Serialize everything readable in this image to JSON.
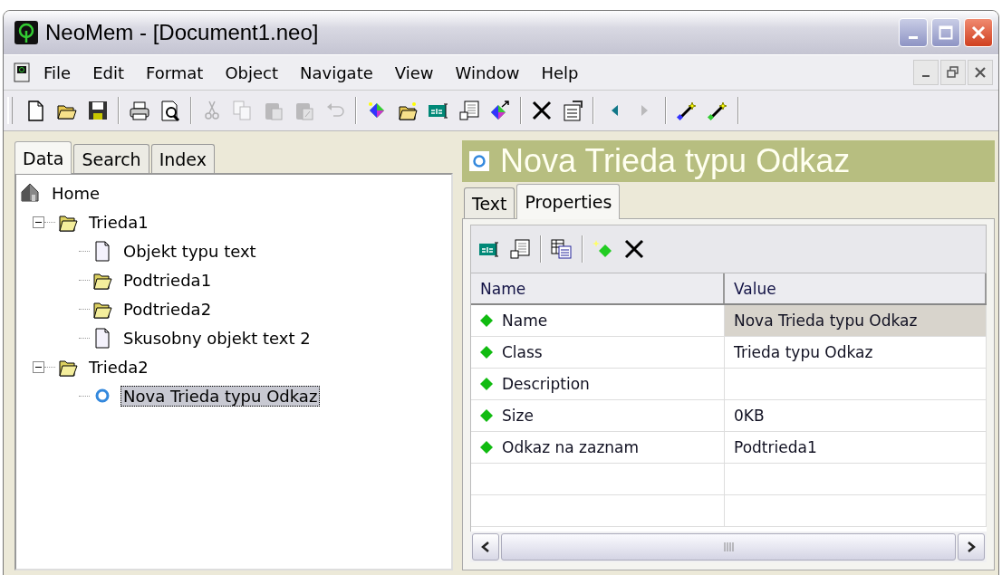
{
  "window": {
    "title": "NeoMem - [Document1.neo]"
  },
  "menu": [
    {
      "label": "File"
    },
    {
      "label": "Edit"
    },
    {
      "label": "Format"
    },
    {
      "label": "Object"
    },
    {
      "label": "Navigate"
    },
    {
      "label": "View"
    },
    {
      "label": "Window"
    },
    {
      "label": "Help"
    }
  ],
  "main_toolbar": [
    {
      "kind": "button",
      "disabled": false
    },
    {
      "kind": "button",
      "disabled": false
    },
    {
      "kind": "button",
      "disabled": false
    },
    {
      "kind": "separator"
    },
    {
      "kind": "button",
      "disabled": false
    },
    {
      "kind": "button",
      "disabled": false
    },
    {
      "kind": "separator"
    },
    {
      "kind": "button",
      "disabled": true
    },
    {
      "kind": "button",
      "disabled": true
    },
    {
      "kind": "button",
      "disabled": true
    },
    {
      "kind": "button",
      "disabled": true
    },
    {
      "kind": "button",
      "disabled": true
    },
    {
      "kind": "separator"
    },
    {
      "kind": "button",
      "disabled": false
    },
    {
      "kind": "button",
      "disabled": false
    },
    {
      "kind": "button",
      "disabled": false
    },
    {
      "kind": "button",
      "disabled": false
    },
    {
      "kind": "button",
      "disabled": false
    },
    {
      "kind": "separator"
    },
    {
      "kind": "button",
      "disabled": false
    },
    {
      "kind": "button",
      "disabled": false
    },
    {
      "kind": "separator"
    },
    {
      "kind": "button",
      "disabled": false
    },
    {
      "kind": "button",
      "disabled": true
    },
    {
      "kind": "separator"
    },
    {
      "kind": "button",
      "disabled": false
    },
    {
      "kind": "button",
      "disabled": false
    },
    {
      "kind": "separator"
    }
  ],
  "left_tabs": [
    {
      "label": "Data",
      "selected": true
    },
    {
      "label": "Search",
      "selected": false
    },
    {
      "label": "Index",
      "selected": false
    }
  ],
  "tree": [
    {
      "label": "Home",
      "kind": "home",
      "selected": false,
      "children": [
        {
          "label": "Trieda1",
          "kind": "folder",
          "selected": false,
          "expanded": true,
          "children": [
            {
              "label": "Objekt typu text",
              "kind": "document",
              "selected": false
            },
            {
              "label": "Podtrieda1",
              "kind": "folder",
              "selected": false
            },
            {
              "label": "Podtrieda2",
              "kind": "folder",
              "selected": false
            },
            {
              "label": "Skusobny objekt text 2",
              "kind": "document",
              "selected": false
            }
          ]
        },
        {
          "label": "Trieda2",
          "kind": "folder",
          "selected": false,
          "expanded": true,
          "children": [
            {
              "label": "Nova Trieda typu Odkaz",
              "kind": "link",
              "selected": true
            }
          ]
        }
      ]
    }
  ],
  "header": {
    "title": "Nova Trieda typu Odkaz"
  },
  "right_tabs": [
    {
      "label": "Text",
      "selected": false
    },
    {
      "label": "Properties",
      "selected": true
    }
  ],
  "properties_toolbar": [
    {
      "kind": "button",
      "disabled": false
    },
    {
      "kind": "button",
      "disabled": false
    },
    {
      "kind": "separator"
    },
    {
      "kind": "button",
      "disabled": false
    },
    {
      "kind": "separator"
    },
    {
      "kind": "button",
      "disabled": false
    },
    {
      "kind": "button",
      "disabled": false
    }
  ],
  "table": {
    "columns": [
      "Name",
      "Value"
    ],
    "rows": [
      {
        "name": "Name",
        "value": "Nova Trieda typu Odkaz",
        "selected": true
      },
      {
        "name": "Class",
        "value": "Trieda typu Odkaz",
        "selected": false
      },
      {
        "name": "Description",
        "selected": false
      },
      {
        "name": "Size",
        "value": "0KB",
        "selected": false
      },
      {
        "name": "Odkaz na zaznam",
        "value": "Podtrieda1",
        "selected": false
      }
    ]
  }
}
